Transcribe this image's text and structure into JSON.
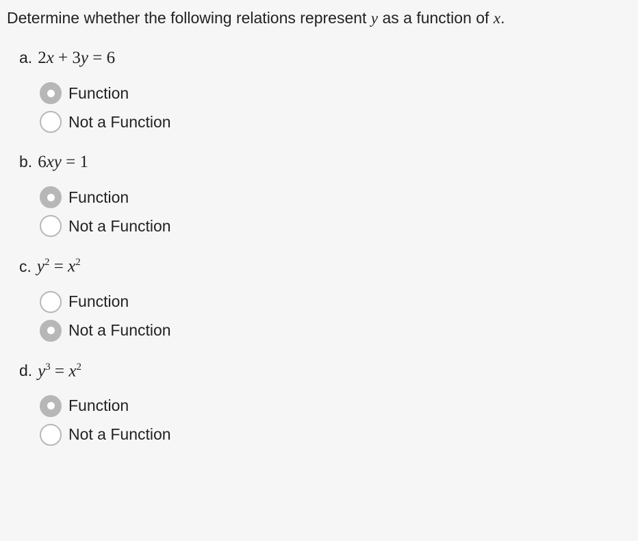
{
  "prompt_prefix": "Determine whether the following relations represent ",
  "prompt_var1": "y",
  "prompt_mid": " as a function of ",
  "prompt_var2": "x",
  "prompt_suffix": ".",
  "option_labels": {
    "function": "Function",
    "not_function": "Not a Function"
  },
  "questions": [
    {
      "letter": "a.",
      "equation_html": "2<span class='var'>x</span> + 3<span class='var'>y</span> = 6",
      "selected": "function"
    },
    {
      "letter": "b.",
      "equation_html": "6<span class='var'>xy</span> = 1",
      "selected": "function"
    },
    {
      "letter": "c.",
      "equation_html": "<span class='var'>y</span><sup>2</sup> = <span class='var'>x</span><sup>2</sup>",
      "selected": "not_function"
    },
    {
      "letter": "d.",
      "equation_html": "<span class='var'>y</span><sup>3</sup> = <span class='var'>x</span><sup>2</sup>",
      "selected": "function"
    }
  ]
}
